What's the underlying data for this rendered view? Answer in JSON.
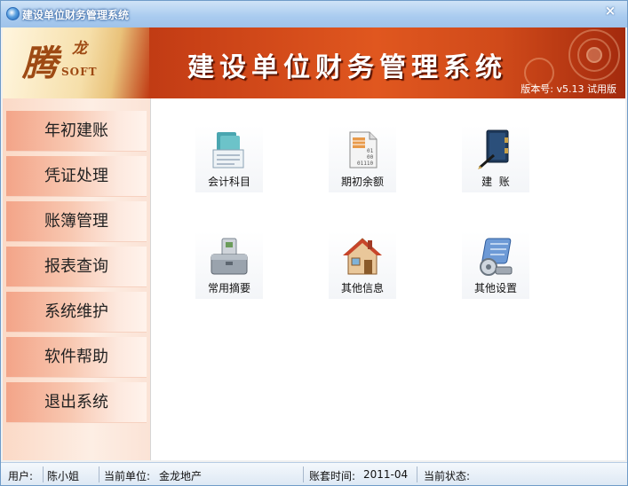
{
  "window": {
    "title": "建设单位财务管理系统",
    "close_glyph": "×"
  },
  "banner": {
    "logo_main": "腾",
    "logo_sub": "龙",
    "logo_soft": "SOFT",
    "title": "建设单位财务管理系统",
    "version": "版本号: v5.13  试用版"
  },
  "sidebar": {
    "items": [
      {
        "label": "年初建账"
      },
      {
        "label": "凭证处理"
      },
      {
        "label": "账簿管理"
      },
      {
        "label": "报表查询"
      },
      {
        "label": "系统维护"
      },
      {
        "label": "软件帮助"
      },
      {
        "label": "退出系统"
      }
    ]
  },
  "tiles": [
    {
      "label": "会计科目",
      "icon": "ledger-book-icon"
    },
    {
      "label": "期初余额",
      "icon": "binary-document-icon"
    },
    {
      "label": "建  账",
      "icon": "account-book-pen-icon"
    },
    {
      "label": "常用摘要",
      "icon": "toolbox-icon"
    },
    {
      "label": "其他信息",
      "icon": "house-icon"
    },
    {
      "label": "其他设置",
      "icon": "settings-panel-icon"
    }
  ],
  "status": {
    "user_label": "用户:",
    "user_value": "陈小姐",
    "unit_label": "当前单位:",
    "unit_value": "金龙地产",
    "period_label": "账套时间:",
    "period_value": "2011-04",
    "state_label": "当前状态:",
    "state_value": ""
  },
  "colors": {
    "accent": "#d84a1a",
    "sidebar_item": "#f3a488",
    "titlebar": "#a9cbef"
  }
}
